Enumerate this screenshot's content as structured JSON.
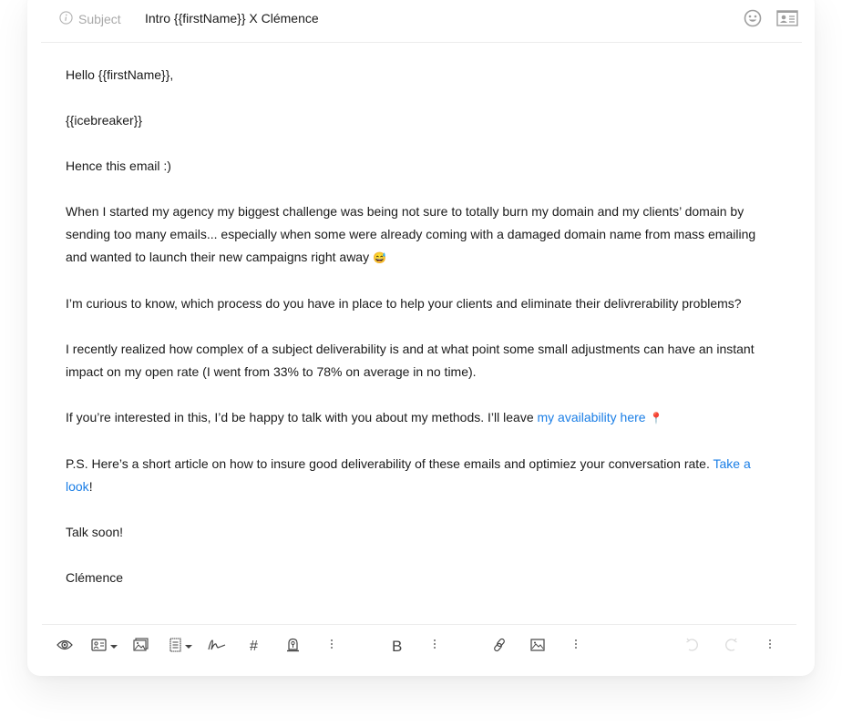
{
  "header": {
    "subject_label": "Subject",
    "subject_value": "Intro {{firstName}} X Clémence",
    "icons": [
      "info-icon",
      "emoji-icon",
      "contact-card-icon"
    ]
  },
  "body": {
    "p1": "Hello {{firstName}},",
    "p2": "{{icebreaker}}",
    "p3": "Hence this email :)",
    "p4": "When I started my agency my biggest challenge was being not sure to totally burn my domain and my clients’ domain by sending too many emails... especially when some were already coming with a damaged domain name from mass emailing and wanted to launch their new campaigns right away",
    "p4_emoji": "😅",
    "p5": "I’m curious to know, which process do you have in place to help your clients and eliminate their delivrerability problems?",
    "p6": "I recently realized how complex of a subject deliverability is and at what point some small adjustments can have an instant impact on my open rate (I went from 33% to 78% on average in no time).",
    "p7_before": "If you’re interested in this, I’d be happy to talk with you about my methods. I’ll leave ",
    "p7_link": "my availability here",
    "p7_emoji": "📍",
    "p8_before": "P.S. Here’s a short article on how to insure good deliverability of these emails and optimiez your conversation rate. ",
    "p8_link": "Take a look",
    "p8_after": "!",
    "p9": "Talk soon!",
    "p10": "Clémence",
    "link_color": "#1a7ee6"
  },
  "toolbar": {
    "items": [
      "preview-eye",
      "variables-dropdown",
      "insert-image",
      "templates-dropdown",
      "signature",
      "hashtag",
      "spintax",
      "more",
      "bold",
      "more",
      "link",
      "image",
      "more",
      "undo",
      "redo",
      "more"
    ],
    "bold_label": "B",
    "hash_label": "#"
  }
}
